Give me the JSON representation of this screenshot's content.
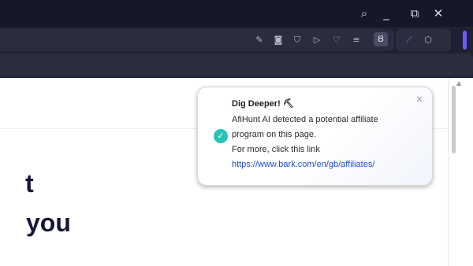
{
  "browser": {
    "window_controls": {
      "search_glyph": "⌕",
      "minimize_glyph": "_",
      "restore_glyph": "⧉",
      "close_glyph": "✕"
    },
    "toolbar_icons": [
      {
        "name": "edit-icon",
        "glyph": "✎"
      },
      {
        "name": "camera-icon",
        "glyph": "◙"
      },
      {
        "name": "shield-icon",
        "glyph": "⛉"
      },
      {
        "name": "send-icon",
        "glyph": "▷"
      },
      {
        "name": "heart-icon",
        "glyph": "♡"
      },
      {
        "name": "list-icon",
        "glyph": "≡"
      }
    ],
    "extension_active_glyph": "Ȣ",
    "extension_group": [
      {
        "name": "share-icon",
        "glyph": "⟋"
      },
      {
        "name": "cube-icon",
        "glyph": "⬡"
      }
    ]
  },
  "page": {
    "heading_line_1": "t",
    "heading_line_2": "you"
  },
  "notification": {
    "title": "Dig Deeper! ⛏",
    "line_1": "AfiHunt AI detected a potential affiliate",
    "line_2": "program on this page.",
    "line_3": "For more, click this link",
    "link": "https://www.bark.com/en/gb/affiliates/",
    "close_glyph": "×",
    "check_glyph": "✓"
  },
  "scroll": {
    "up_glyph": "▲"
  }
}
